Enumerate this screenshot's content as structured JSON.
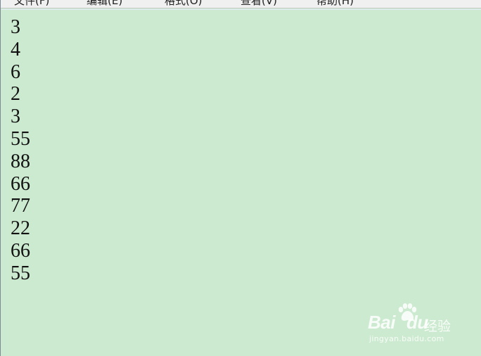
{
  "menubar": {
    "items": [
      {
        "label": "文件(F)"
      },
      {
        "label": "编辑(E)"
      },
      {
        "label": "格式(O)"
      },
      {
        "label": "查看(V)"
      },
      {
        "label": "帮助(H)"
      }
    ]
  },
  "editor": {
    "lines": [
      "3",
      "4",
      "6",
      "2",
      "3",
      "55",
      "88",
      "66",
      "77",
      "22",
      "66",
      "55"
    ],
    "background_color": "#ccead0"
  },
  "watermark": {
    "brand": "Bai",
    "brand_suffix": "du",
    "cn_text": "经验",
    "url": "jingyan.baidu.com",
    "icon": "baidu-paw-icon"
  }
}
